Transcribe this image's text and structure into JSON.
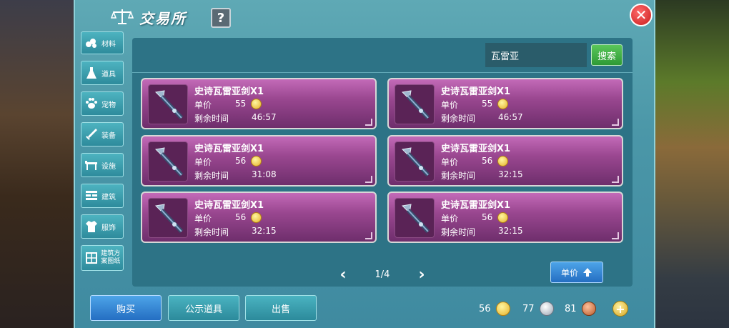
{
  "window": {
    "title": "交易所",
    "help_label": "?",
    "close_label": "✕"
  },
  "sidebar": {
    "items": [
      {
        "label": "材料",
        "icon": "materials-icon"
      },
      {
        "label": "道具",
        "icon": "flask-icon"
      },
      {
        "label": "宠物",
        "icon": "paw-icon"
      },
      {
        "label": "装备",
        "icon": "sword-icon"
      },
      {
        "label": "设施",
        "icon": "facility-icon"
      },
      {
        "label": "建筑",
        "icon": "brick-icon"
      },
      {
        "label": "服饰",
        "icon": "shirt-icon"
      },
      {
        "label": "建筑方案图纸",
        "icon": "blueprint-icon"
      }
    ]
  },
  "search": {
    "value": "瓦雷亚",
    "button_label": "搜索"
  },
  "listings": [
    {
      "name": "史诗瓦雷亚剑X1",
      "price_label": "单价",
      "price": "55",
      "time_label": "剩余时间",
      "time": "46:57"
    },
    {
      "name": "史诗瓦雷亚剑X1",
      "price_label": "单价",
      "price": "55",
      "time_label": "剩余时间",
      "time": "46:57"
    },
    {
      "name": "史诗瓦雷亚剑X1",
      "price_label": "单价",
      "price": "56",
      "time_label": "剩余时间",
      "time": "31:08"
    },
    {
      "name": "史诗瓦雷亚剑X1",
      "price_label": "单价",
      "price": "56",
      "time_label": "剩余时间",
      "time": "32:15"
    },
    {
      "name": "史诗瓦雷亚剑X1",
      "price_label": "单价",
      "price": "56",
      "time_label": "剩余时间",
      "time": "32:15"
    },
    {
      "name": "史诗瓦雷亚剑X1",
      "price_label": "单价",
      "price": "56",
      "time_label": "剩余时间",
      "time": "32:15"
    }
  ],
  "pager": {
    "prev": "‹",
    "page": "1/4",
    "next": "›"
  },
  "sort": {
    "label": "单价"
  },
  "actions": {
    "buy": "购买",
    "show": "公示道具",
    "sell": "出售"
  },
  "currency": {
    "gold": "56",
    "silver": "77",
    "bronze": "81",
    "add_label": "+"
  },
  "colors": {
    "panel": "#4b97a8",
    "card": "#9a4790",
    "accent_blue": "#246ec2",
    "accent_green": "#2e9a35"
  }
}
